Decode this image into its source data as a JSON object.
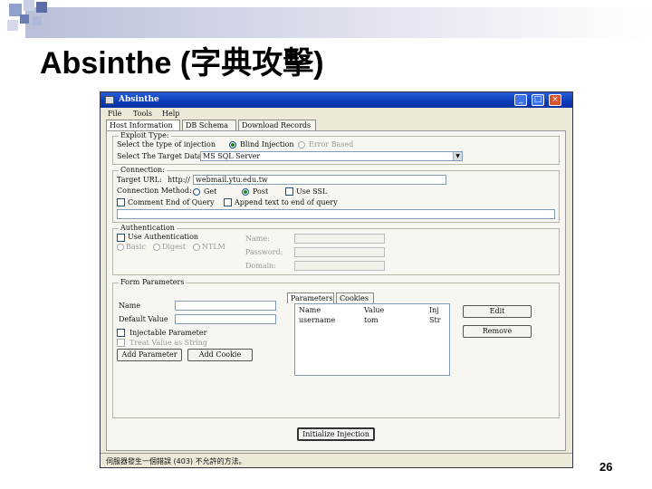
{
  "slide": {
    "title": "Absinthe (字典攻擊)",
    "page_number": "26"
  },
  "window": {
    "title": "Absinthe",
    "controls": {
      "minimize": "_",
      "maximize": "□",
      "close": "×"
    },
    "menu": [
      "File",
      "Tools",
      "Help"
    ],
    "tabs": [
      "Host Information",
      "DB Schema",
      "Download Records"
    ]
  },
  "exploit": {
    "legend": "Exploit Type:",
    "type_label": "Select the type of injection",
    "blind_label": "Blind Injection",
    "error_label": "Error Based",
    "db_label": "Select The Target Database",
    "db_value": "MS SQL Server"
  },
  "connection": {
    "legend": "Connection:",
    "url_label": "Target URL:",
    "url_prefix": "http://",
    "url_value": "webmail.ytu.edu.tw",
    "method_label": "Connection Method:",
    "get_label": "Get",
    "post_label": "Post",
    "ssl_label": "Use SSL",
    "comment_label": "Comment End of Query",
    "append_label": "Append text to end of query"
  },
  "auth": {
    "legend": "Authentication",
    "use_auth_label": "Use Authentication",
    "basic_label": "Basic",
    "digest_label": "Digest",
    "ntlm_label": "NTLM",
    "name_label": "Name:",
    "password_label": "Password:",
    "domain_label": "Domain:"
  },
  "params": {
    "legend": "Form Parameters",
    "name_label": "Name",
    "default_label": "Default Value",
    "injectable_label": "Injectable Parameter",
    "string_label": "Treat Value as String",
    "add_param_button": "Add Parameter",
    "add_cookie_button": "Add Cookie",
    "sub_tabs": [
      "Parameters",
      "Cookies"
    ],
    "columns": [
      "Name",
      "Value",
      "Inj"
    ],
    "rows": [
      [
        "username",
        "tom",
        "Str"
      ]
    ],
    "edit_button": "Edit",
    "remove_button": "Remove"
  },
  "init_button": "Initialize Injection",
  "status_text": "伺服器發生一個錯誤 (403) 不允許的方法。",
  "colors": {
    "titlebar": "#0a3bb8",
    "window_bg": "#ece9d8",
    "close_button": "#d9532f",
    "radio_selected": "#1a8a1a"
  }
}
